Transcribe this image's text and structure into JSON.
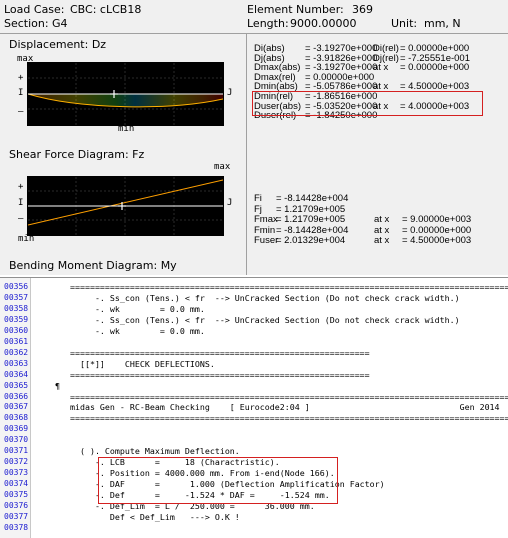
{
  "header": {
    "load_case_label": "Load Case:",
    "load_case_value": "CBC: cLCB18",
    "section_label": "Section:",
    "section_value": "G4",
    "element_label": "Element Number:",
    "element_value": "369",
    "length_label": "Length:",
    "length_value": "9000.00000",
    "unit_label": "Unit:",
    "unit_value": "mm,  N"
  },
  "displacement": {
    "title": "Displacement: Dz",
    "axis_max": "max",
    "axis_min": "min",
    "end_i": "I",
    "end_j": "J",
    "plus": "+",
    "minus": "–",
    "rows": [
      {
        "label": "Di(abs)",
        "value": "= -3.19270e+000",
        "label2": "Di(rel)",
        "value2": "= 0.00000e+000",
        "red": false
      },
      {
        "label": "Dj(abs)",
        "value": "= -3.91826e+000",
        "label2": "Dj(rel)",
        "value2": "= -7.25551e-001",
        "red": false
      },
      {
        "label": "Dmax(abs)",
        "value": "= -3.19270e+000",
        "label2": "at x",
        "value2": "= 0.00000e+000",
        "red": false
      },
      {
        "label": "Dmax(rel)",
        "value": "= 0.00000e+000",
        "label2": "",
        "value2": "",
        "red": false
      },
      {
        "label": "Dmin(abs)",
        "value": "= -5.05786e+000",
        "label2": "at x",
        "value2": "= 4.50000e+003",
        "red": false
      },
      {
        "label": "Dmin(rel)",
        "value": "= -1.86516e+000",
        "label2": "",
        "value2": "",
        "red": false
      },
      {
        "label": "Duser(abs)",
        "value": "= -5.03520e+000",
        "label2": "at x",
        "value2": "= 4.00000e+003",
        "red": true
      },
      {
        "label": "Duser(rel)",
        "value": "= -1.84250e+000",
        "label2": "",
        "value2": "",
        "red": false
      }
    ]
  },
  "shear": {
    "title": "Shear Force Diagram: Fz",
    "axis_max": "max",
    "axis_min": "min",
    "end_i": "I",
    "end_j": "J",
    "plus": "+",
    "minus": "–",
    "rows": [
      {
        "label": "Fi",
        "value": "= -8.14428e+004",
        "label2": "",
        "value2": "",
        "red": false
      },
      {
        "label": "Fj",
        "value": "= 1.21709e+005",
        "label2": "",
        "value2": "",
        "red": false
      },
      {
        "label": "Fmax",
        "value": "= 1.21709e+005",
        "label2": "at x",
        "value2": "= 9.00000e+003",
        "red": false
      },
      {
        "label": "Fmin",
        "value": "= -8.14428e+004",
        "label2": "at x",
        "value2": "= 0.00000e+000",
        "red": false
      },
      {
        "label": "Fuser",
        "value": "= 2.01329e+004",
        "label2": "at x",
        "value2": "= 4.50000e+003",
        "red": true
      }
    ]
  },
  "bending": {
    "title": "Bending Moment Diagram: My"
  },
  "code": {
    "lines": [
      {
        "num": "00356",
        "text": "       =========================================================================================="
      },
      {
        "num": "00357",
        "text": "            -. Ss_con (Tens.) < fr  --> UnCracked Section (Do not check crack width.)"
      },
      {
        "num": "00358",
        "text": "            -. wk        = 0.0 mm."
      },
      {
        "num": "00359",
        "text": "            -. Ss_con (Tens.) < fr  --> UnCracked Section (Do not check crack width.)"
      },
      {
        "num": "00360",
        "text": "            -. wk        = 0.0 mm."
      },
      {
        "num": "00361",
        "text": ""
      },
      {
        "num": "00362",
        "text": "       ============================================================"
      },
      {
        "num": "00363",
        "text": "         [[*]]    CHECK DEFLECTIONS."
      },
      {
        "num": "00364",
        "text": "       ============================================================"
      },
      {
        "num": "00365",
        "text": "    ¶"
      },
      {
        "num": "00366",
        "text": "       =========================================================================================="
      },
      {
        "num": "00367",
        "text": "       midas Gen - RC-Beam Checking    [ Eurocode2:04 ]                              Gen 2014"
      },
      {
        "num": "00368",
        "text": "       =========================================================================================="
      },
      {
        "num": "00369",
        "text": ""
      },
      {
        "num": "00370",
        "text": ""
      },
      {
        "num": "00371",
        "text": "         ( ). Compute Maximum Deflection."
      },
      {
        "num": "00372",
        "text": "            -. LCB      =     18 (Charactristic)."
      },
      {
        "num": "00373",
        "text": "            -. Position = 4000.000 mm. From i-end(Node 166)."
      },
      {
        "num": "00374",
        "text": "            -. DAF      =      1.000 (Deflection Amplification Factor)"
      },
      {
        "num": "00375",
        "text": "            -. Def      =     -1.524 * DAF =     -1.524 mm."
      },
      {
        "num": "00376",
        "text": "            -. Def_Lim  = L /  250.000 =      36.000 mm."
      },
      {
        "num": "00377",
        "text": "               Def < Def_Lim   ---> O.K !"
      },
      {
        "num": "00378",
        "text": ""
      }
    ]
  },
  "colors": {
    "highlight_box": "#d42020",
    "red_text": "#e00000",
    "line_numbers": "#1a1ad0"
  }
}
